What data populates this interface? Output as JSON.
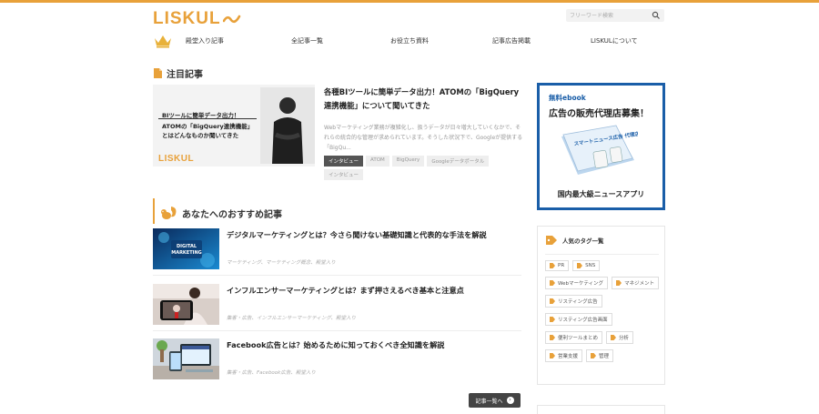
{
  "header": {
    "logo_text": "LISKUL",
    "search_placeholder": "フリーワード検索"
  },
  "nav": {
    "items": [
      "殿堂入り記事",
      "全記事一覧",
      "お役立ち資料",
      "記事広告掲載",
      "LISKULについて"
    ]
  },
  "featured": {
    "section_title": "注目記事",
    "image_text": {
      "line1": "BIツールに簡単データ出力！",
      "line2": "ATOMの「BigQuery連携機能」",
      "line3": "とはどんなものか聞いてきた",
      "logo": "LISKUL"
    },
    "title": "各種BIツールに簡単データ出力！ATOMの「BigQuery連携機能」について聞いてきた",
    "excerpt": "Webマーケティング業務が複雑化し、扱うデータが日々増大していくなかで、それらの統合的な管理が求められています。そうした状況下で、Googleが提供する「BigQu...",
    "tags": [
      "インタビュー",
      "ATOM",
      "BigQuery",
      "Googleデータポータル",
      "インタビュー"
    ]
  },
  "recommended": {
    "section_title": "あなたへのおすすめ記事",
    "items": [
      {
        "title": "デジタルマーケティングとは？今さら聞けない基礎知識と代表的な手法を解説",
        "category": "マーケティング、マーケティング概念、殿堂入り",
        "thumb_text": "DIGITAL MARKETING"
      },
      {
        "title": "インフルエンサーマーケティングとは？まず押さえるべき基本と注意点",
        "category": "集客・広告、インフルエンサーマーケティング、殿堂入り"
      },
      {
        "title": "Facebook広告とは？始めるために知っておくべき全知識を解説",
        "category": "集客・広告、Facebook広告、殿堂入り"
      }
    ],
    "more_label": "記事一覧へ"
  },
  "ad": {
    "line1": "無料ebook",
    "line2": "広告の販売代理店募集！",
    "book_title": "スマートニュース広告 代理店加盟ブック",
    "line3": "国内最大級ニュースアプリ"
  },
  "tag_panel": {
    "title": "人気のタグ一覧",
    "tags": [
      "PR",
      "SNS",
      "Webマーケティング",
      "マネジメント",
      "リスティング広告",
      "リスティング広告画面",
      "便利ツールまとめ",
      "分析",
      "営業支援",
      "管理"
    ]
  },
  "colors": {
    "accent": "#e8a13a",
    "ad_border": "#1a5ea8",
    "dark_button": "#444444"
  }
}
